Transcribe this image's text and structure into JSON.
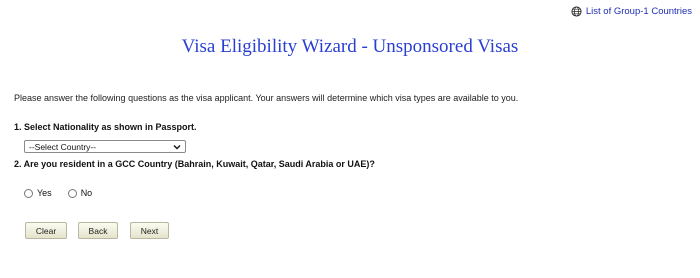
{
  "header": {
    "link_label": "List of Group-1 Countries",
    "link_icon": "globe-icon",
    "title": "Visa Eligibility Wizard - Unsponsored Visas"
  },
  "intro": "Please answer the following questions as the visa applicant. Your answers will determine which visa types are available to you.",
  "question1": {
    "label": "1. Select Nationality as shown in Passport.",
    "select_value": "--Select Country--"
  },
  "question2": {
    "label": "2. Are you resident in a GCC Country (Bahrain, Kuwait, Qatar, Saudi Arabia or UAE)?",
    "options": [
      "Yes",
      "No"
    ]
  },
  "buttons": {
    "clear": "Clear",
    "back": "Back",
    "next": "Next"
  },
  "colors": {
    "title": "#2a3fd2",
    "link": "#1f2fb0",
    "button_bg": "#ecebd6"
  }
}
